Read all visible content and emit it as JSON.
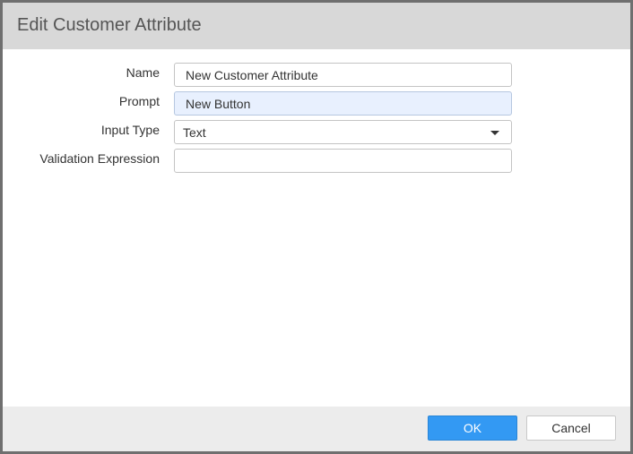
{
  "dialog": {
    "title": "Edit Customer Attribute"
  },
  "form": {
    "name": {
      "label": "Name",
      "value": "New Customer Attribute"
    },
    "prompt": {
      "label": "Prompt",
      "value": "New Button"
    },
    "input_type": {
      "label": "Input Type",
      "value": "Text"
    },
    "validation_expression": {
      "label": "Validation Expression",
      "value": ""
    }
  },
  "footer": {
    "ok_label": "OK",
    "cancel_label": "Cancel"
  },
  "colors": {
    "titlebar": "#d8d8d8",
    "footer": "#ececec",
    "primary_button": "#3399f3",
    "focused_field": "#e8f0fe"
  },
  "icons": {
    "select_caret": "chevron-down-icon"
  }
}
